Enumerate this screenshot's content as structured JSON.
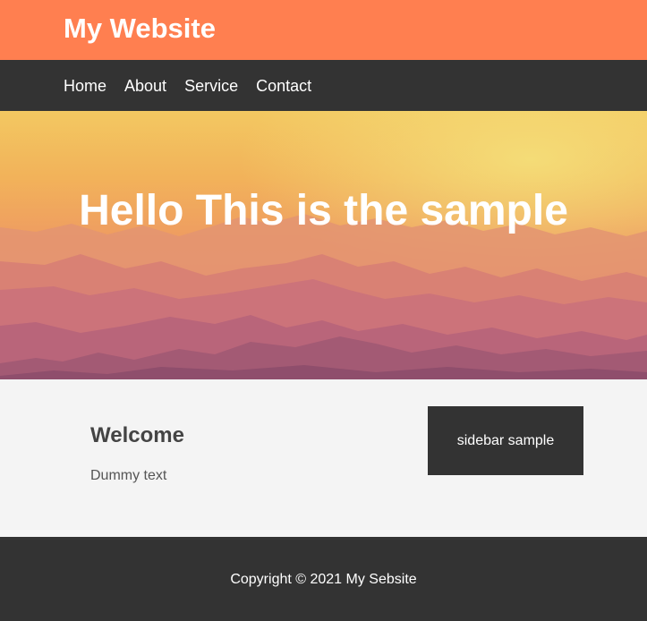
{
  "header": {
    "title": "My Website"
  },
  "nav": {
    "items": [
      {
        "label": "Home"
      },
      {
        "label": "About"
      },
      {
        "label": "Service"
      },
      {
        "label": "Contact"
      }
    ]
  },
  "hero": {
    "heading": "Hello This is the sample",
    "background": "sunset-mountains-image"
  },
  "main": {
    "heading": "Welcome",
    "text": "Dummy text"
  },
  "sidebar": {
    "text": "sidebar sample"
  },
  "footer": {
    "copyright": "Copyright © 2021 My Sebsite"
  },
  "colors": {
    "header_bg": "#ff7f50",
    "nav_bg": "#333333",
    "main_bg": "#f4f4f4",
    "footer_bg": "#333333"
  }
}
